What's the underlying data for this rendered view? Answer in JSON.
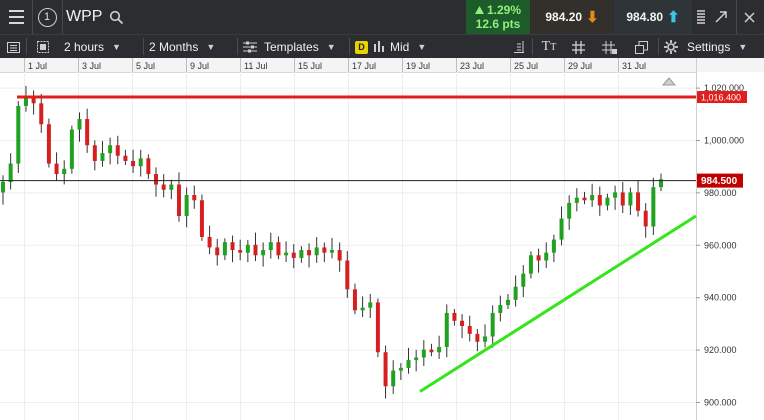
{
  "header": {
    "menu_icon": "hamburger-icon",
    "info_label": "1",
    "symbol": "WPP",
    "search_icon": "search-icon",
    "change_pct": "1.29%",
    "change_pts": "12.6 pts",
    "sell_price": "984.20",
    "buy_price": "984.80",
    "window_icons": [
      "grip-icon",
      "popout-icon",
      "close-icon"
    ]
  },
  "toolbar": {
    "interval": "2 hours",
    "range": "2 Months",
    "templates": "Templates",
    "price_badge": "D",
    "price_type": "Mid",
    "settings": "Settings"
  },
  "colors": {
    "up": "#1fa21f",
    "down": "#d62020",
    "resistance": "#e01e1e",
    "support": "#33e61a",
    "current_line": "#202020"
  },
  "chart_data": {
    "type": "candlestick",
    "x_tick_labels": [
      "1 Jul",
      "3 Jul",
      "5 Jul",
      "9 Jul",
      "11 Jul",
      "15 Jul",
      "17 Jul",
      "19 Jul",
      "23 Jul",
      "25 Jul",
      "29 Jul",
      "31 Jul"
    ],
    "y_tick_labels": [
      "1,020.000",
      "1,000.000",
      "980.000",
      "960.000",
      "940.000",
      "920.000",
      "900.000"
    ],
    "ylim": [
      898,
      1027
    ],
    "resistance_level": 1016.4,
    "resistance_label": "1,016.400",
    "current_price": 984.5,
    "current_label": "984.500",
    "support_line": {
      "from": 904,
      "to": 971
    },
    "series": [
      {
        "name": "WPP",
        "closes": [
          984,
          991,
          1013,
          1016,
          1014,
          1006,
          991,
          987,
          989,
          1004,
          1008,
          998,
          992,
          995,
          998,
          994,
          992,
          990,
          993,
          987,
          983,
          981,
          983,
          971,
          979,
          977,
          963,
          959,
          956,
          961,
          958,
          957,
          960,
          956,
          958,
          961,
          956,
          957,
          955,
          958,
          956,
          959,
          957,
          958,
          954,
          943,
          935,
          936,
          938,
          919,
          906,
          912,
          913,
          916,
          917,
          920,
          919,
          921,
          934,
          931,
          929,
          926,
          923,
          925,
          934,
          937,
          939,
          944,
          949,
          956,
          954,
          957,
          962,
          970,
          976,
          978,
          977,
          979,
          975,
          978,
          980,
          975,
          980,
          973,
          967,
          982,
          985
        ]
      }
    ]
  }
}
